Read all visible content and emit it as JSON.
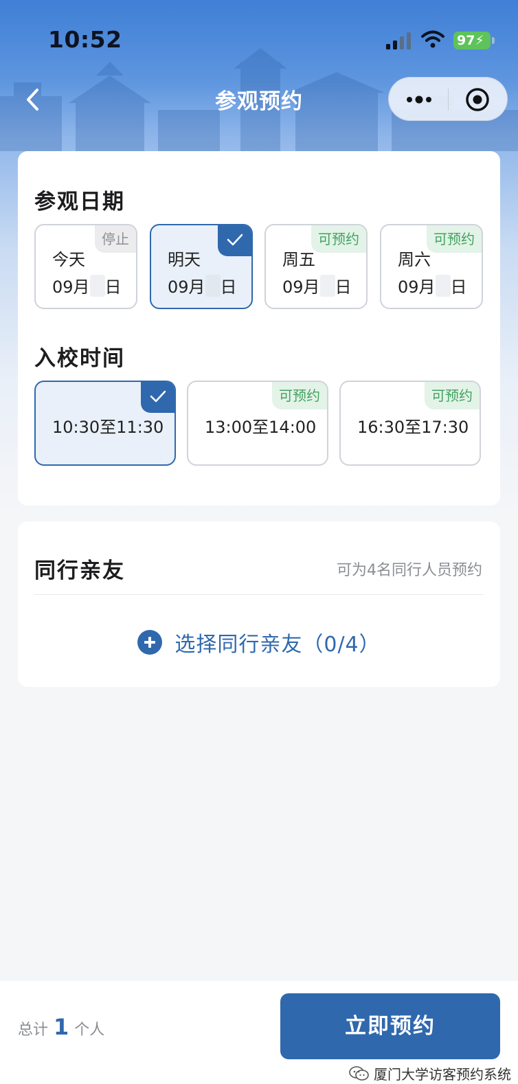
{
  "status_bar": {
    "time": "10:52",
    "battery": "97"
  },
  "nav": {
    "title": "参观预约"
  },
  "visit_date": {
    "title": "参观日期",
    "options": [
      {
        "day": "今天",
        "month": "09月",
        "suffix": "日",
        "tag": "停止",
        "status": "stopped",
        "selected": false
      },
      {
        "day": "明天",
        "month": "09月",
        "suffix": "日",
        "tag": "",
        "status": "selected",
        "selected": true
      },
      {
        "day": "周五",
        "month": "09月",
        "suffix": "日",
        "tag": "可预约",
        "status": "available",
        "selected": false
      },
      {
        "day": "周六",
        "month": "09月",
        "suffix": "日",
        "tag": "可预约",
        "status": "available",
        "selected": false
      }
    ]
  },
  "entry_time": {
    "title": "入校时间",
    "options": [
      {
        "label": "10:30至11:30",
        "tag": "",
        "selected": true
      },
      {
        "label": "13:00至14:00",
        "tag": "可预约",
        "selected": false
      },
      {
        "label": "16:30至17:30",
        "tag": "可预约",
        "selected": false
      }
    ]
  },
  "companions": {
    "title": "同行亲友",
    "hint": "可为4名同行人员预约",
    "add_label": "选择同行亲友（0/4）"
  },
  "footer": {
    "total_prefix": "总计",
    "total_count": "1",
    "total_suffix": "个人",
    "book_button": "立即预约",
    "watermark": "厦门大学访客预约系统"
  },
  "colors": {
    "primary": "#2f68ad",
    "available_tag": "#43a261",
    "stopped_tag": "#8d8f94"
  },
  "icons": [
    "back-icon",
    "more-icon",
    "target-icon",
    "check-icon",
    "plus-icon",
    "wechat-icon",
    "signal-icon",
    "wifi-icon"
  ]
}
